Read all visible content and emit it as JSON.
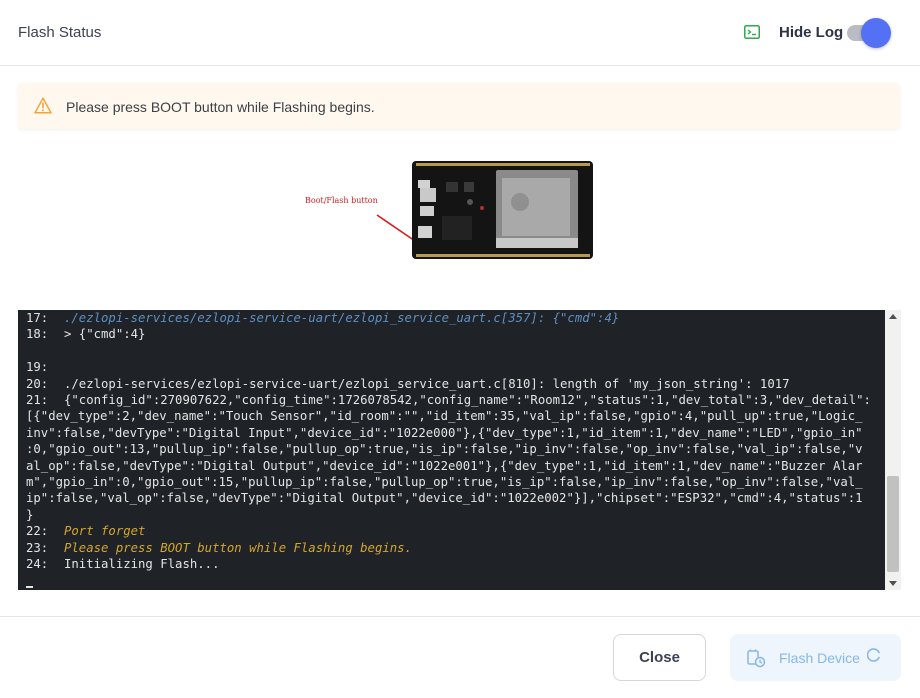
{
  "header": {
    "title": "Flash Status",
    "hide_log_label": "Hide Log",
    "toggle_on": true,
    "accent_color": "#5470f5"
  },
  "alert": {
    "message": "Please press BOOT button while Flashing begins.",
    "icon": "warning-icon"
  },
  "board_image": {
    "label": "Boot/Flash button"
  },
  "log": {
    "lines": [
      {
        "num": "17:",
        "text": "./ezlopi-services/ezlopi-service-uart/ezlopi_service_uart.c[357]: {\"cmd\":4}",
        "style": "dim"
      },
      {
        "num": "18:",
        "text": "> {\"cmd\":4}",
        "style": ""
      },
      {
        "num": "",
        "text": "",
        "style": ""
      },
      {
        "num": "19:",
        "text": "",
        "style": ""
      },
      {
        "num": "20:",
        "text": "./ezlopi-services/ezlopi-service-uart/ezlopi_service_uart.c[810]: length of 'my_json_string': 1017",
        "style": ""
      },
      {
        "num": "21:",
        "text": "{\"config_id\":270907622,\"config_time\":1726078542,\"config_name\":\"Room12\",\"status\":1,\"dev_total\":3,\"dev_detail\":",
        "style": ""
      },
      {
        "num": "",
        "text": "[{\"dev_type\":2,\"dev_name\":\"Touch Sensor\",\"id_room\":\"\",\"id_item\":35,\"val_ip\":false,\"gpio\":4,\"pull_up\":true,\"Logic_",
        "style": "",
        "wrap": true
      },
      {
        "num": "",
        "text": "inv\":false,\"devType\":\"Digital Input\",\"device_id\":\"1022e000\"},{\"dev_type\":1,\"id_item\":1,\"dev_name\":\"LED\",\"gpio_in\"",
        "style": "",
        "wrap": true
      },
      {
        "num": "",
        "text": ":0,\"gpio_out\":13,\"pullup_ip\":false,\"pullup_op\":true,\"is_ip\":false,\"ip_inv\":false,\"op_inv\":false,\"val_ip\":false,\"v",
        "style": "",
        "wrap": true
      },
      {
        "num": "",
        "text": "al_op\":false,\"devType\":\"Digital Output\",\"device_id\":\"1022e001\"},{\"dev_type\":1,\"id_item\":1,\"dev_name\":\"Buzzer Alar",
        "style": "",
        "wrap": true
      },
      {
        "num": "",
        "text": "m\",\"gpio_in\":0,\"gpio_out\":15,\"pullup_ip\":false,\"pullup_op\":true,\"is_ip\":false,\"ip_inv\":false,\"op_inv\":false,\"val_",
        "style": "",
        "wrap": true
      },
      {
        "num": "",
        "text": "ip\":false,\"val_op\":false,\"devType\":\"Digital Output\",\"device_id\":\"1022e002\"}],\"chipset\":\"ESP32\",\"cmd\":4,\"status\":1",
        "style": "",
        "wrap": true
      },
      {
        "num": "",
        "text": "}",
        "style": "",
        "wrap": true
      },
      {
        "num": "22:",
        "text": "Port forget",
        "style": "yellow"
      },
      {
        "num": "23:",
        "text": "Please press BOOT button while Flashing begins.",
        "style": "yellow"
      },
      {
        "num": "24:",
        "text": "Initializing Flash...",
        "style": ""
      }
    ]
  },
  "footer": {
    "close_label": "Close",
    "flash_label": "Flash Device"
  }
}
